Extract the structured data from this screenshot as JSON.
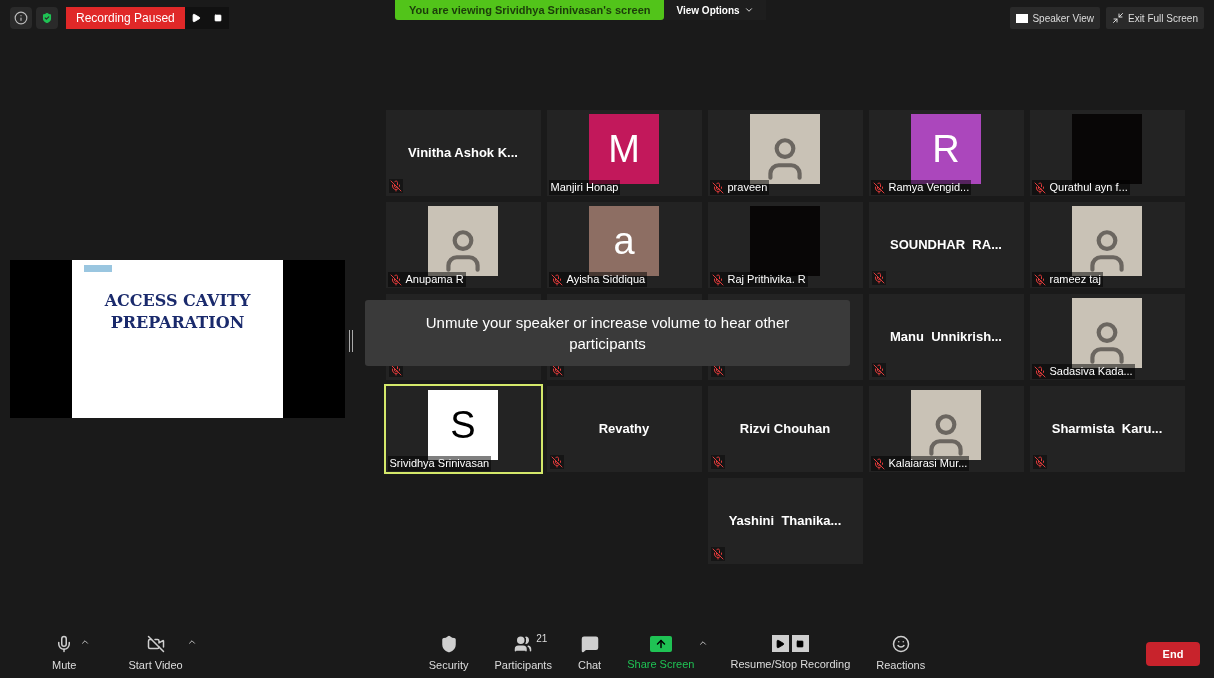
{
  "top_bar": {
    "recording_status": "Recording Paused",
    "banner": "You are viewing Srividhya Srinivasan's screen",
    "view_options": "View Options",
    "speaker_view": "Speaker View",
    "exit_full_screen": "Exit Full Screen"
  },
  "shared_slide": {
    "title_lines": [
      "ACCESS CAVITY",
      "PREPARATION"
    ]
  },
  "notice": "Unmute your speaker or increase volume to hear other participants",
  "participants": [
    {
      "name": "Vinitha Ashok K...",
      "kind": "name",
      "muted": true,
      "active": false
    },
    {
      "name": "Manjiri Honap",
      "kind": "letter",
      "letter": "M",
      "color": "#c2185b",
      "muted": false,
      "active": false
    },
    {
      "name": "praveen",
      "kind": "photo",
      "muted": true,
      "active": false
    },
    {
      "name": "Ramya Vengid...",
      "kind": "letter",
      "letter": "R",
      "color": "#ab47bc",
      "muted": true,
      "active": false
    },
    {
      "name": "Qurathul ayn f...",
      "kind": "blank",
      "muted": true,
      "active": false
    },
    {
      "name": "Anupama R",
      "kind": "photo",
      "muted": true,
      "active": false
    },
    {
      "name": "Ayisha Siddiqua",
      "kind": "letter",
      "letter": "a",
      "color": "#8d6e63",
      "muted": true,
      "active": false
    },
    {
      "name": "Raj Prithivika. R",
      "kind": "blank",
      "muted": true,
      "active": false
    },
    {
      "name": "SOUNDHAR  RA...",
      "kind": "name",
      "muted": true,
      "active": false
    },
    {
      "name": "rameez taj",
      "kind": "photo",
      "muted": true,
      "active": false
    },
    {
      "kind": "covered",
      "muted": true,
      "active": false
    },
    {
      "kind": "covered",
      "muted": true,
      "active": false
    },
    {
      "kind": "covered",
      "muted": true,
      "active": false
    },
    {
      "name": "Manu  Unnikrish...",
      "kind": "name",
      "muted": true,
      "active": false
    },
    {
      "name": "Sadasiva Kada...",
      "kind": "photo",
      "muted": true,
      "active": false
    },
    {
      "name": "Srividhya Srinivasan",
      "kind": "letter",
      "letter": "S",
      "color": "#ffffff",
      "muted": false,
      "active": true
    },
    {
      "name": "Revathy",
      "kind": "name",
      "muted": true,
      "active": false
    },
    {
      "name": "Rizvi Chouhan",
      "kind": "name",
      "muted": true,
      "active": false
    },
    {
      "name": "Kalaiarasi Mur...",
      "kind": "photo",
      "muted": true,
      "active": false
    },
    {
      "name": "Sharmista  Karu...",
      "kind": "name",
      "muted": true,
      "active": false
    },
    {
      "name": "Yashini  Thanika...",
      "kind": "name",
      "muted": true,
      "active": false
    }
  ],
  "toolbar": [
    {
      "label": "Mute",
      "kind": "mic",
      "caret": true,
      "highlighted": false
    },
    {
      "label": "Start Video",
      "kind": "video",
      "caret": true,
      "highlighted": false
    },
    {
      "label": "Security",
      "kind": "security",
      "caret": false,
      "highlighted": false
    },
    {
      "label": "Participants",
      "kind": "participants",
      "count": "21",
      "caret": false,
      "highlighted": false
    },
    {
      "label": "Chat",
      "kind": "chat",
      "caret": false,
      "highlighted": false
    },
    {
      "label": "Share Screen",
      "kind": "share",
      "caret": true,
      "highlighted": true
    },
    {
      "label": "Resume/Stop Recording",
      "kind": "recording",
      "caret": false,
      "highlighted": false
    },
    {
      "label": "Reactions",
      "kind": "reactions",
      "caret": false,
      "highlighted": false
    }
  ],
  "end_button": "End"
}
